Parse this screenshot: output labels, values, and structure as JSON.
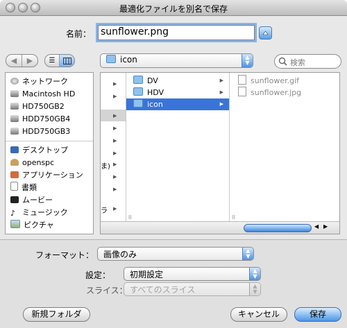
{
  "window": {
    "title": "最適化ファイルを別名で保存"
  },
  "filename": {
    "label": "名前：",
    "value": "sunflower.png"
  },
  "toolbar": {
    "location": "icon",
    "search_placeholder": "検索"
  },
  "sidebar": {
    "devices": [
      "ネットワーク",
      "Macintosh HD",
      "HD750GB2",
      "HDD750GB4",
      "HDD750GB3"
    ],
    "places": [
      "デスクトップ",
      "openspc",
      "アプリケーション",
      "書類",
      "ムービー",
      "ミュージック",
      "ピクチャ"
    ]
  },
  "browser": {
    "col1_fragments": [
      "ま)",
      "ラ"
    ],
    "col2": [
      {
        "name": "DV",
        "selected": false
      },
      {
        "name": "HDV",
        "selected": false
      },
      {
        "name": "icon",
        "selected": true
      }
    ],
    "col3": [
      "sunflower.gif",
      "sunflower.jpg"
    ]
  },
  "options": {
    "format_label": "フォーマット：",
    "format_value": "画像のみ",
    "settings_label": "設定：",
    "settings_value": "初期設定",
    "slices_label": "スライス：",
    "slices_value": "すべてのスライス"
  },
  "buttons": {
    "new_folder": "新規フォルダ",
    "cancel": "キャンセル",
    "save": "保存"
  },
  "colors": {
    "selection": "#3a74d8",
    "accent": "#5a9ee6"
  }
}
